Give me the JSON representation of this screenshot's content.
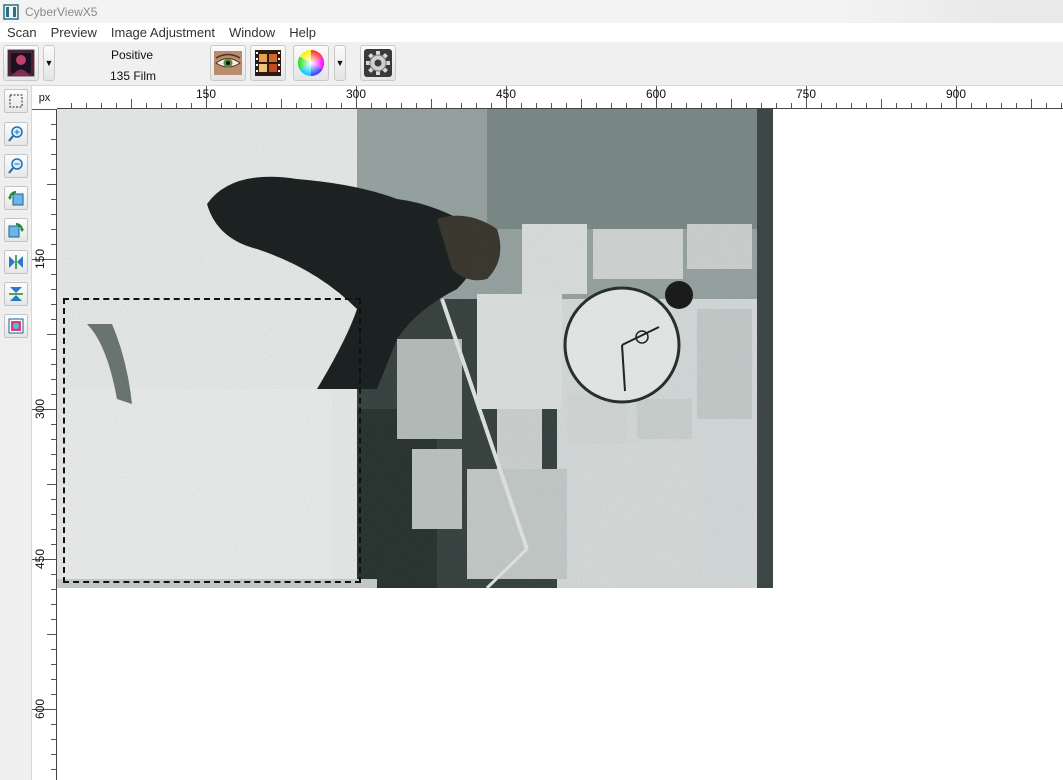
{
  "window": {
    "title": "CyberViewX5"
  },
  "menu": {
    "items": [
      {
        "label": "Scan"
      },
      {
        "label": "Preview"
      },
      {
        "label": "Image Adjustment"
      },
      {
        "label": "Window"
      },
      {
        "label": "Help"
      }
    ]
  },
  "toolbar": {
    "scan_mode_line1": "Positive",
    "scan_mode_line2": "135 Film",
    "icons": [
      "portrait-preview-icon",
      "eye-icon",
      "filmstrip-icon",
      "color-wheel-icon",
      "gear-icon"
    ]
  },
  "sidebar": {
    "tools": [
      "marquee-select-icon",
      "zoom-in-icon",
      "zoom-out-icon",
      "rotate-left-icon",
      "rotate-right-icon",
      "flip-horizontal-icon",
      "flip-vertical-icon",
      "fit-image-icon"
    ]
  },
  "ruler": {
    "unit": "px",
    "h_labels": [
      "150",
      "300",
      "450",
      "600",
      "750",
      "900"
    ],
    "v_labels": [
      "150",
      "300",
      "450",
      "600"
    ]
  },
  "colors": {
    "selection_border": "#111111",
    "toolbar_bg": "#f0f0f0",
    "ruler_bg": "#ffffff"
  }
}
